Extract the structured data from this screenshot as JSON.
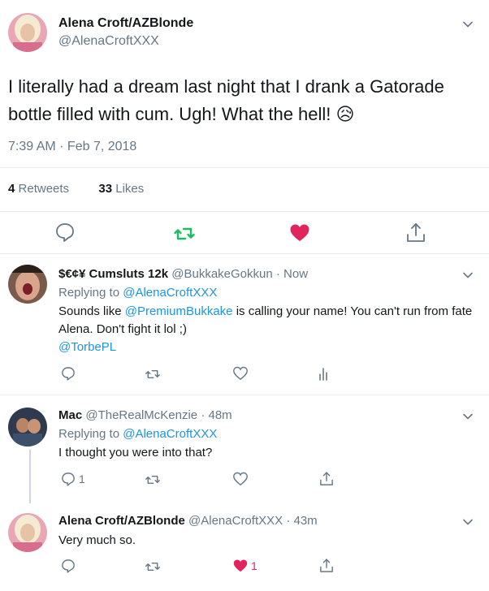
{
  "main_tweet": {
    "name": "Alena Croft/AZBlonde",
    "handle": "@AlenaCroftXXX",
    "text": "I literally had a dream last night that I drank a Gatorade bottle filled with cum. Ugh! What the hell!",
    "emoji": "😥",
    "timestamp": "7:39 AM · Feb 7, 2018",
    "retweets_count": "4",
    "retweets_label": "Retweets",
    "likes_count": "33",
    "likes_label": "Likes"
  },
  "replies": [
    {
      "name": "$€¢¥ Cumsluts 12k",
      "handle": "@BukkakeGokkun",
      "time": "Now",
      "replying_label": "Replying to",
      "replying_to": "@AlenaCroftXXX",
      "text_before": "Sounds like",
      "mention": "@PremiumBukkake",
      "text_after": "is calling your name! You can't run from fate Alena. Don't fight it lol ;)",
      "extra_mention": "@TorbePL"
    },
    {
      "name": "Mac",
      "handle": "@TheRealMcKenzie",
      "time": "48m",
      "replying_label": "Replying to",
      "replying_to": "@AlenaCroftXXX",
      "text": "I thought you were into that?",
      "reply_count": "1"
    },
    {
      "name": "Alena Croft/AZBlonde",
      "handle": "@AlenaCroftXXX",
      "time": "43m",
      "text": "Very much so.",
      "like_count": "1"
    }
  ],
  "colors": {
    "link": "#1b95e0",
    "retweet_green": "#17bf63",
    "like_red": "#e0245e",
    "secondary_text": "#657786"
  }
}
